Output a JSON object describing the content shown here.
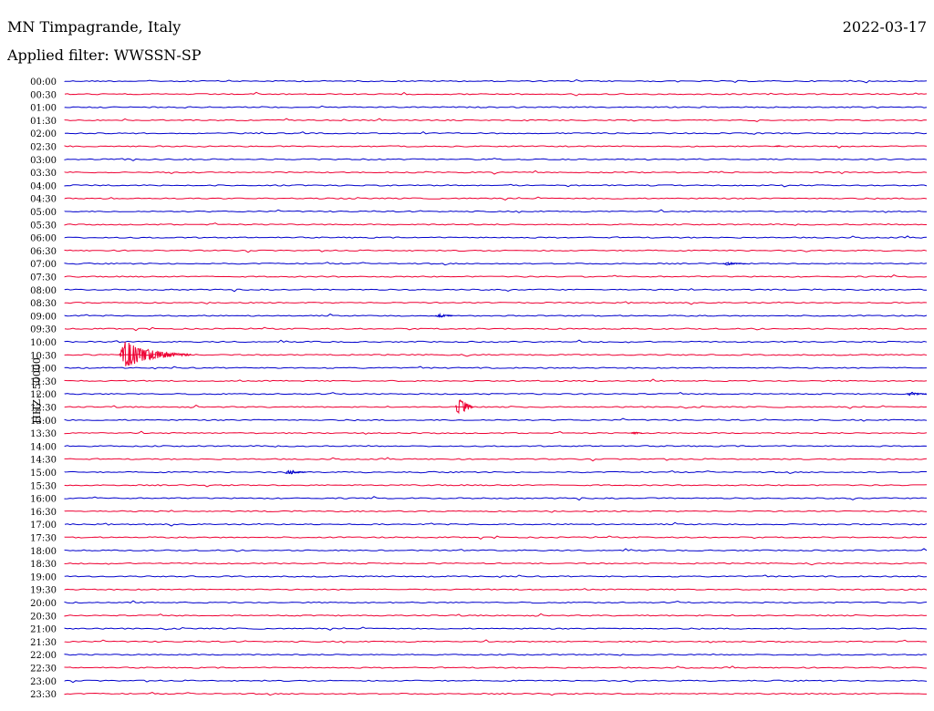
{
  "header": {
    "station": "MN Timpagrande, Italy",
    "date": "2022-03-17",
    "filter": "Applied filter: WWSSN-SP"
  },
  "colors": {
    "even_row": "#0000cc",
    "odd_row": "#ee0033",
    "background": "#ffffff"
  },
  "chart_data": {
    "type": "line",
    "title": "MN Timpagrande, Italy",
    "ylabel": "HHZ - 50000",
    "xlabel": "",
    "grid": false,
    "y_ticks": [
      "00:00",
      "00:30",
      "01:00",
      "01:30",
      "02:00",
      "02:30",
      "03:00",
      "03:30",
      "04:00",
      "04:30",
      "05:00",
      "05:30",
      "06:00",
      "06:30",
      "07:00",
      "07:30",
      "08:00",
      "08:30",
      "09:00",
      "09:30",
      "10:00",
      "10:30",
      "11:00",
      "11:30",
      "12:00",
      "12:30",
      "13:00",
      "13:30",
      "14:00",
      "14:30",
      "15:00",
      "15:30",
      "16:00",
      "16:30",
      "17:00",
      "17:30",
      "18:00",
      "18:30",
      "19:00",
      "19:30",
      "20:00",
      "20:30",
      "21:00",
      "21:30",
      "22:00",
      "22:30",
      "23:00",
      "23:30"
    ],
    "row_minutes": 30,
    "events": [
      {
        "row": "10:30",
        "minute_offset": 1.9,
        "duration_min": 2.5,
        "amplitude_rows": 1.4,
        "label": ""
      },
      {
        "row": "12:30",
        "minute_offset": 13.6,
        "duration_min": 0.6,
        "amplitude_rows": 1.9,
        "label": ""
      },
      {
        "row": "13:30",
        "minute_offset": 19.7,
        "duration_min": 0.4,
        "amplitude_rows": 0.3,
        "label": ""
      },
      {
        "row": "15:00",
        "minute_offset": 7.7,
        "duration_min": 0.7,
        "amplitude_rows": 0.4,
        "label": ""
      },
      {
        "row": "09:00",
        "minute_offset": 12.9,
        "duration_min": 0.6,
        "amplitude_rows": 0.3,
        "label": ""
      },
      {
        "row": "12:00",
        "minute_offset": 29.3,
        "duration_min": 0.7,
        "amplitude_rows": 0.3,
        "label": ""
      },
      {
        "row": "07:00",
        "minute_offset": 22.9,
        "duration_min": 0.8,
        "amplitude_rows": 0.2,
        "label": ""
      },
      {
        "row": "02:30",
        "minute_offset": 24.7,
        "duration_min": 0.2,
        "amplitude_rows": 0.2,
        "label": ""
      }
    ]
  }
}
